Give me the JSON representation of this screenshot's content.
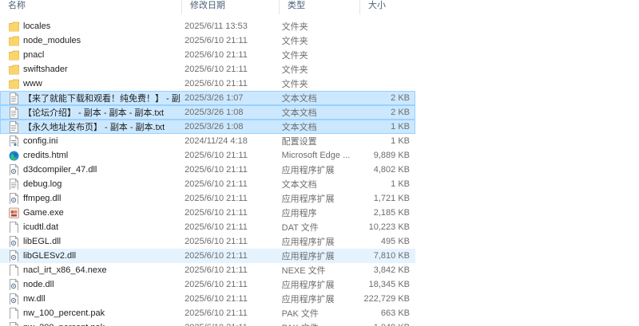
{
  "columns": {
    "name": "名称",
    "date": "修改日期",
    "type": "类型",
    "size": "大小"
  },
  "colors": {
    "selected_bg": "#cce8ff",
    "selected_border": "#99d1ff",
    "hover_bg": "#e5f3ff",
    "folder": "#f8d775"
  },
  "files": [
    {
      "name": "locales",
      "date": "2025/6/11 13:53",
      "type": "文件夹",
      "size": "",
      "icon": "folder-icon",
      "state": ""
    },
    {
      "name": "node_modules",
      "date": "2025/6/10 21:11",
      "type": "文件夹",
      "size": "",
      "icon": "folder-icon",
      "state": ""
    },
    {
      "name": "pnacl",
      "date": "2025/6/10 21:11",
      "type": "文件夹",
      "size": "",
      "icon": "folder-icon",
      "state": ""
    },
    {
      "name": "swiftshader",
      "date": "2025/6/10 21:11",
      "type": "文件夹",
      "size": "",
      "icon": "folder-icon",
      "state": ""
    },
    {
      "name": "www",
      "date": "2025/6/10 21:11",
      "type": "文件夹",
      "size": "",
      "icon": "folder-icon",
      "state": ""
    },
    {
      "name": "【来了就能下载和观看！纯免费！】 - 副...",
      "date": "2025/3/26 1:07",
      "type": "文本文档",
      "size": "2 KB",
      "icon": "text-document-icon",
      "state": "selected"
    },
    {
      "name": "【论坛介绍】 - 副本 - 副本 - 副本.txt",
      "date": "2025/3/26 1:08",
      "type": "文本文档",
      "size": "2 KB",
      "icon": "text-document-icon",
      "state": "selected"
    },
    {
      "name": "【永久地址发布页】 - 副本 - 副本.txt",
      "date": "2025/3/26 1:08",
      "type": "文本文档",
      "size": "1 KB",
      "icon": "text-document-icon",
      "state": "selected"
    },
    {
      "name": "config.ini",
      "date": "2024/11/24 4:18",
      "type": "配置设置",
      "size": "1 KB",
      "icon": "config-file-icon",
      "state": ""
    },
    {
      "name": "credits.html",
      "date": "2025/6/10 21:11",
      "type": "Microsoft Edge ...",
      "size": "9,889 KB",
      "icon": "edge-html-icon",
      "state": ""
    },
    {
      "name": "d3dcompiler_47.dll",
      "date": "2025/6/10 21:11",
      "type": "应用程序扩展",
      "size": "4,802 KB",
      "icon": "dll-file-icon",
      "state": ""
    },
    {
      "name": "debug.log",
      "date": "2025/6/10 21:11",
      "type": "文本文档",
      "size": "1 KB",
      "icon": "text-document-icon",
      "state": ""
    },
    {
      "name": "ffmpeg.dll",
      "date": "2025/6/10 21:11",
      "type": "应用程序扩展",
      "size": "1,721 KB",
      "icon": "dll-file-icon",
      "state": ""
    },
    {
      "name": "Game.exe",
      "date": "2025/6/10 21:11",
      "type": "应用程序",
      "size": "2,185 KB",
      "icon": "game-exe-icon",
      "state": ""
    },
    {
      "name": "icudtl.dat",
      "date": "2025/6/10 21:11",
      "type": "DAT 文件",
      "size": "10,223 KB",
      "icon": "blank-file-icon",
      "state": ""
    },
    {
      "name": "libEGL.dll",
      "date": "2025/6/10 21:11",
      "type": "应用程序扩展",
      "size": "495 KB",
      "icon": "dll-file-icon",
      "state": ""
    },
    {
      "name": "libGLESv2.dll",
      "date": "2025/6/10 21:11",
      "type": "应用程序扩展",
      "size": "7,810 KB",
      "icon": "dll-file-icon",
      "state": "hover"
    },
    {
      "name": "nacl_irt_x86_64.nexe",
      "date": "2025/6/10 21:11",
      "type": "NEXE 文件",
      "size": "3,842 KB",
      "icon": "blank-file-icon",
      "state": ""
    },
    {
      "name": "node.dll",
      "date": "2025/6/10 21:11",
      "type": "应用程序扩展",
      "size": "18,345 KB",
      "icon": "dll-file-icon",
      "state": ""
    },
    {
      "name": "nw.dll",
      "date": "2025/6/10 21:11",
      "type": "应用程序扩展",
      "size": "222,729 KB",
      "icon": "dll-file-icon",
      "state": ""
    },
    {
      "name": "nw_100_percent.pak",
      "date": "2025/6/10 21:11",
      "type": "PAK 文件",
      "size": "663 KB",
      "icon": "blank-file-icon",
      "state": ""
    },
    {
      "name": "nw_200_percent.pak",
      "date": "2025/6/10 21:11",
      "type": "PAK 文件",
      "size": "1,049 KB",
      "icon": "blank-file-icon",
      "state": ""
    }
  ]
}
